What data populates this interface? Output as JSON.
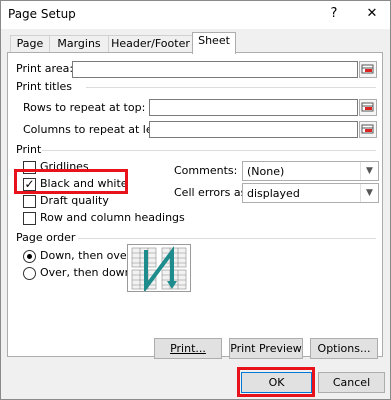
{
  "window": {
    "title": "Page Setup",
    "help_glyph": "?",
    "close_glyph": "✕"
  },
  "tabs": [
    {
      "label": "Page"
    },
    {
      "label": "Margins"
    },
    {
      "label": "Header/Footer"
    },
    {
      "label": "Sheet",
      "active": true
    }
  ],
  "print_area": {
    "label": "Print area:",
    "value": ""
  },
  "print_titles": {
    "heading": "Print titles",
    "rows_label": "Rows to repeat at top:",
    "rows_value": "",
    "cols_label": "Columns to repeat at left:",
    "cols_value": ""
  },
  "print": {
    "heading": "Print",
    "gridlines": {
      "label": "Gridlines",
      "checked": false
    },
    "black_and_white": {
      "label": "Black and white",
      "checked": true
    },
    "draft_quality": {
      "label": "Draft quality",
      "checked": false
    },
    "row_col_headings": {
      "label": "Row and column headings",
      "checked": false
    },
    "comments_label": "Comments:",
    "comments_value": "(None)",
    "cell_errors_label": "Cell errors as:",
    "cell_errors_value": "displayed",
    "check_glyph": "✓"
  },
  "page_order": {
    "heading": "Page order",
    "down_then_over": {
      "label": "Down, then over",
      "selected": true
    },
    "over_then_down": {
      "label": "Over, then down",
      "selected": false
    }
  },
  "buttons": {
    "print": "Print...",
    "print_preview": "Print Preview",
    "options": "Options...",
    "ok": "OK",
    "cancel": "Cancel"
  },
  "colors": {
    "highlight_red": "#e8121b",
    "preview_arrow": "#1e8c8c",
    "focus_blue": "#0078d7"
  }
}
